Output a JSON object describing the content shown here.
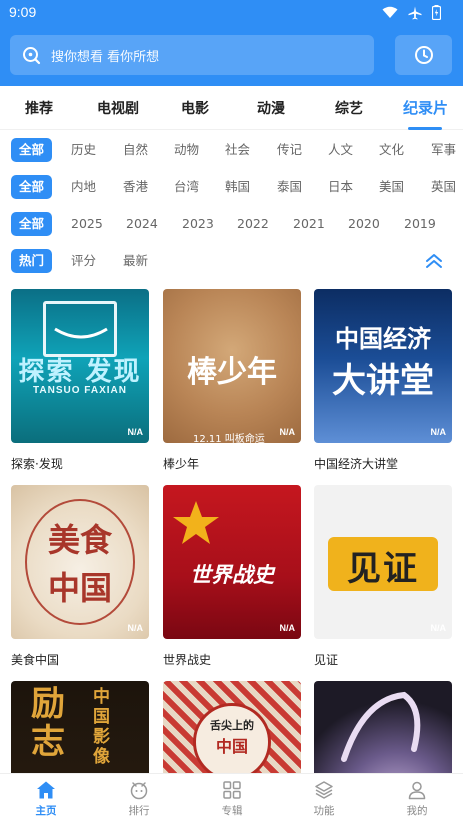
{
  "status_bar": {
    "time": "9:09"
  },
  "search": {
    "placeholder": "搜你想看 看你所想"
  },
  "tabs": [
    {
      "label": "推荐"
    },
    {
      "label": "电视剧"
    },
    {
      "label": "电影"
    },
    {
      "label": "动漫"
    },
    {
      "label": "综艺"
    },
    {
      "label": "纪录片",
      "active": true
    }
  ],
  "filters": {
    "category": {
      "all": "全部",
      "items": [
        "历史",
        "自然",
        "动物",
        "社会",
        "传记",
        "人文",
        "文化",
        "军事"
      ]
    },
    "region": {
      "all": "全部",
      "items": [
        "内地",
        "香港",
        "台湾",
        "韩国",
        "泰国",
        "日本",
        "美国",
        "英国"
      ]
    },
    "year": {
      "all": "全部",
      "items": [
        "2025",
        "2024",
        "2023",
        "2022",
        "2021",
        "2020",
        "2019"
      ]
    },
    "sort": {
      "active": "热门",
      "items": [
        "评分",
        "最新"
      ]
    }
  },
  "cards": [
    {
      "title": "探索·发现",
      "score": "N/A",
      "poster_text": "探索  发现",
      "poster_sub": "TANSUO  FAXIAN"
    },
    {
      "title": "棒少年",
      "score": "N/A",
      "poster_text": "棒少年",
      "poster_sub": "12.11  叫板命运"
    },
    {
      "title": "中国经济大讲堂",
      "score": "N/A",
      "poster_text": "中国经济",
      "poster_sub": "大讲堂"
    },
    {
      "title": "美食中国",
      "score": "N/A",
      "poster_text": "美食",
      "poster_sub": "中国"
    },
    {
      "title": "世界战史",
      "score": "N/A",
      "poster_text": "世界战史",
      "poster_sub": ""
    },
    {
      "title": "见证",
      "score": "N/A",
      "poster_text": "见证",
      "poster_sub": ""
    },
    {
      "title": "",
      "score": "",
      "poster_text": "励志",
      "poster_sub": "中国影像"
    },
    {
      "title": "",
      "score": "",
      "poster_text": "舌尖上的",
      "poster_sub": "中国"
    },
    {
      "title": "",
      "score": "",
      "poster_text": "",
      "poster_sub": ""
    }
  ],
  "bottom_nav": [
    {
      "label": "主页",
      "icon": "home-icon",
      "active": true
    },
    {
      "label": "排行",
      "icon": "ranking-icon"
    },
    {
      "label": "专辑",
      "icon": "grid-icon"
    },
    {
      "label": "功能",
      "icon": "layers-icon"
    },
    {
      "label": "我的",
      "icon": "user-icon"
    }
  ],
  "colors": {
    "accent": "#2f8ef5"
  }
}
